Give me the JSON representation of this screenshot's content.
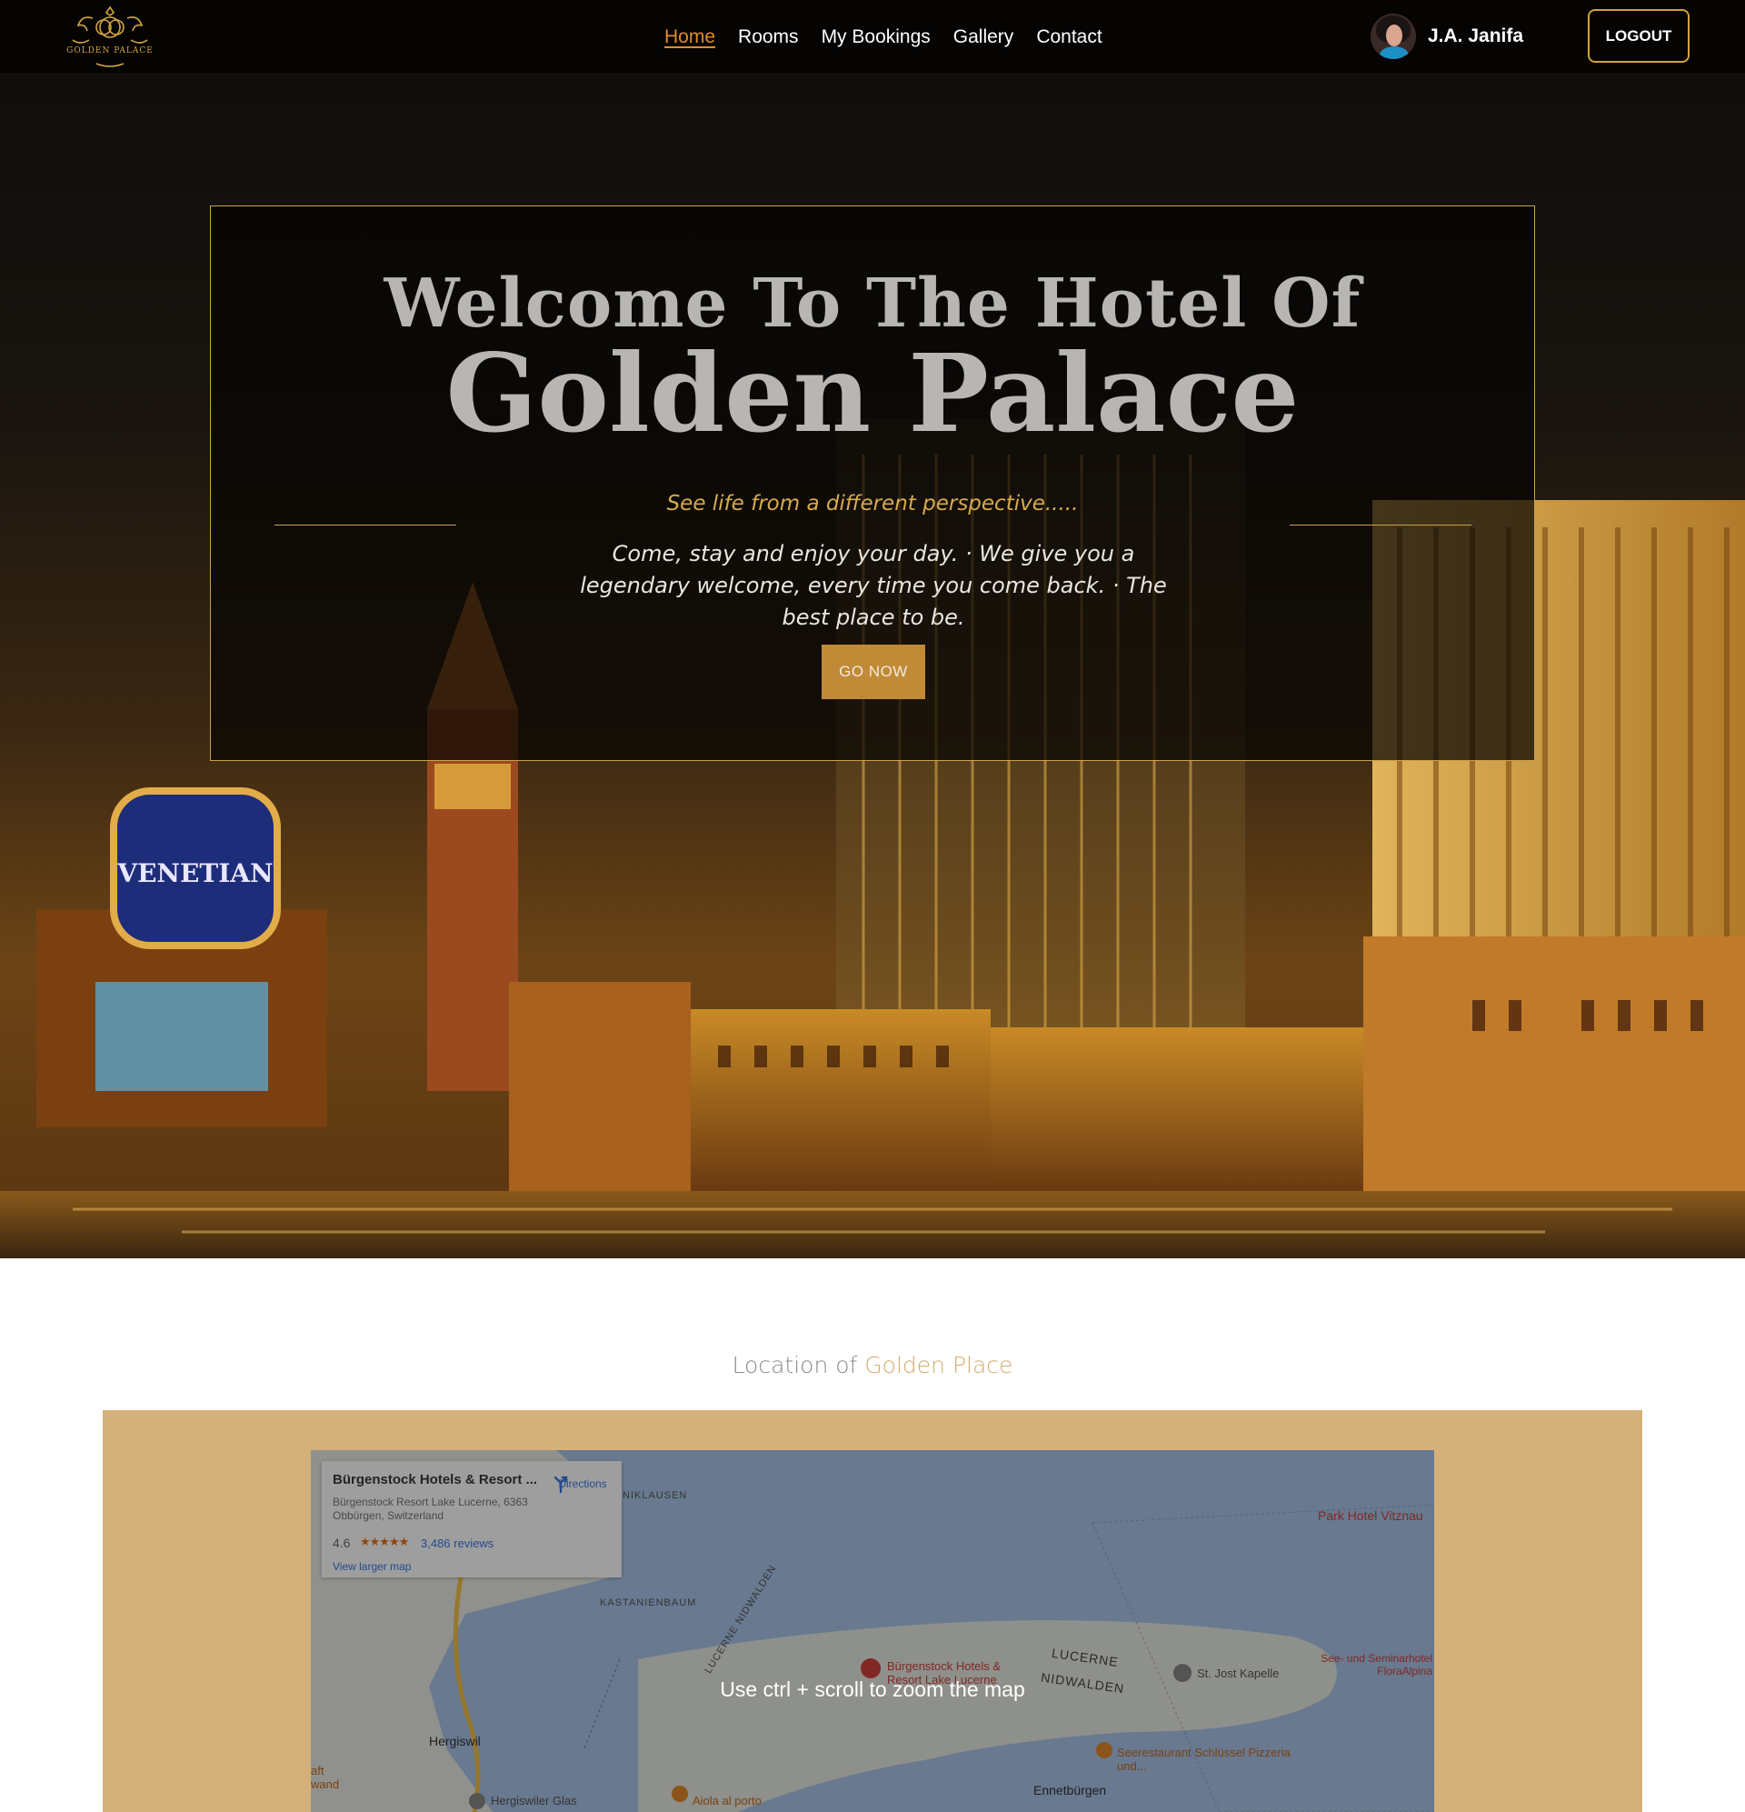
{
  "navbar": {
    "logo_text": "GOLDEN PALACE",
    "links": [
      {
        "label": "Home",
        "active": true
      },
      {
        "label": "Rooms",
        "active": false
      },
      {
        "label": "My Bookings",
        "active": false
      },
      {
        "label": "Gallery",
        "active": false
      },
      {
        "label": "Contact",
        "active": false
      }
    ],
    "user_name": "J.A. Janifa",
    "logout_label": "LOGOUT"
  },
  "hero": {
    "heading_line1": "Welcome To The Hotel Of",
    "heading_line2": "Golden Palace",
    "tagline": "See life from a different perspective.....",
    "intro": "Come, stay and enjoy your day. · We give you a legendary welcome, every time you come back. · The best place to be.",
    "button_label": "GO NOW",
    "sign_text": "VENETIAN"
  },
  "location": {
    "title_prefix": "Location of",
    "title_accent": "Golden Place",
    "map": {
      "card_title": "Bürgenstock Hotels & Resort ...",
      "card_address": "Bürgenstock Resort Lake Lucerne, 6363 Obbürgen, Switzerland",
      "rating": "4.6",
      "stars": "★★★★★",
      "reviews": "3,486 reviews",
      "larger_map": "View larger map",
      "directions": "Directions",
      "zoom_hint": "Use ctrl + scroll to zoom the map",
      "labels": {
        "niklausen": "NIKLAUSEN",
        "park_hotel": "Park Hotel Vitznau",
        "kastanienbaum": "KASTANIENBAUM",
        "lucerne_nidwalden_diag": "LUCERNE NIDWALDEN",
        "lucerne": "LUCERNE",
        "nidwalden": "NIDWALDEN",
        "burgenstock_pin": "Bürgenstock Hotels & Resort Lake Lucerne",
        "st_jost": "St. Jost Kapelle",
        "seminar": "See- und Seminarhotel FloraAlpina",
        "hergiswil": "Hergiswil",
        "seerestaurant": "Seerestaurant Schlüssel Pizzeria und...",
        "ennetburgen": "Ennetbürgen",
        "hergiswiler_glas": "Hergiswiler Glas",
        "aiola": "Aiola al porto",
        "aft": "aft",
        "wand": "wand"
      }
    }
  },
  "colors": {
    "accent_gold": "#c9a24a",
    "active_link": "#e38a2b",
    "button_gold": "#c18a36",
    "map_frame": "#d4b07a"
  }
}
